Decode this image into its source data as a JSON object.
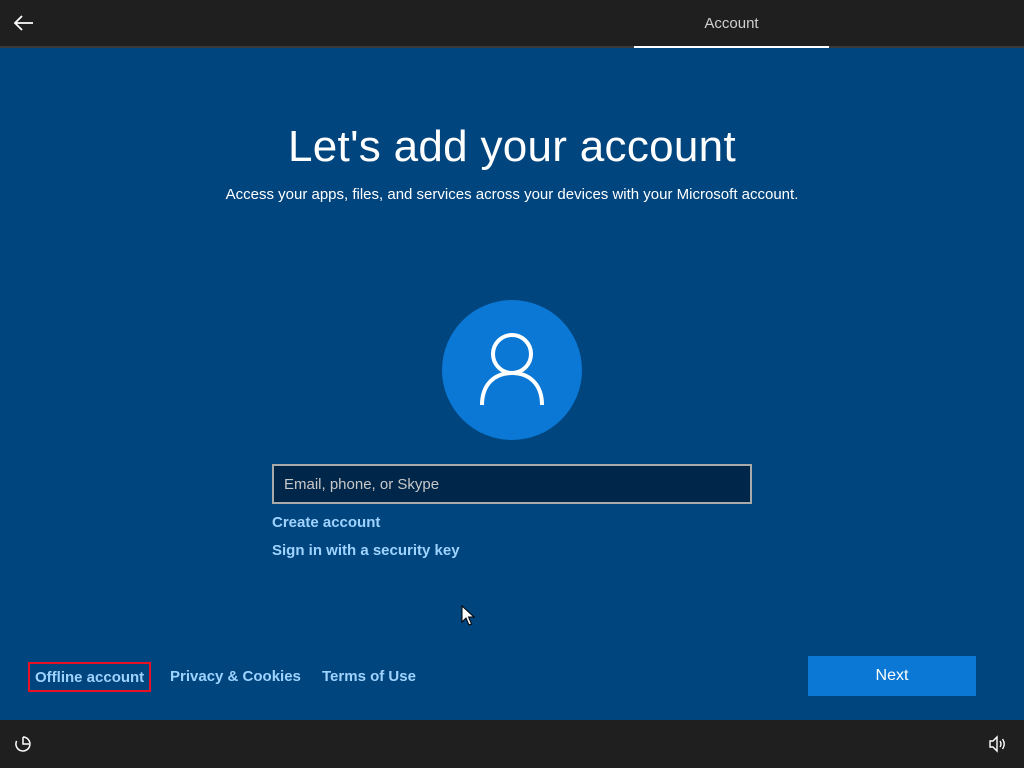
{
  "topbar": {
    "back_icon": "arrow-left-icon",
    "tab_label": "Account"
  },
  "main": {
    "title": "Let's add your account",
    "subtitle": "Access your apps, files, and services across your devices with your Microsoft account.",
    "avatar_icon": "person-icon",
    "email_input": {
      "placeholder": "Email, phone, or Skype",
      "value": ""
    },
    "links": {
      "create_account": "Create account",
      "security_key": "Sign in with a security key"
    }
  },
  "footer": {
    "offline_account": "Offline account",
    "privacy": "Privacy & Cookies",
    "terms": "Terms of Use",
    "next": "Next"
  },
  "bottombar": {
    "left_icon": "ease-of-access-icon",
    "right_icon": "volume-icon"
  },
  "colors": {
    "background": "#00457e",
    "accent": "#0a78d4",
    "link": "#9fd3ff",
    "highlight_border": "#e81123",
    "bar": "#1f1f1f"
  }
}
